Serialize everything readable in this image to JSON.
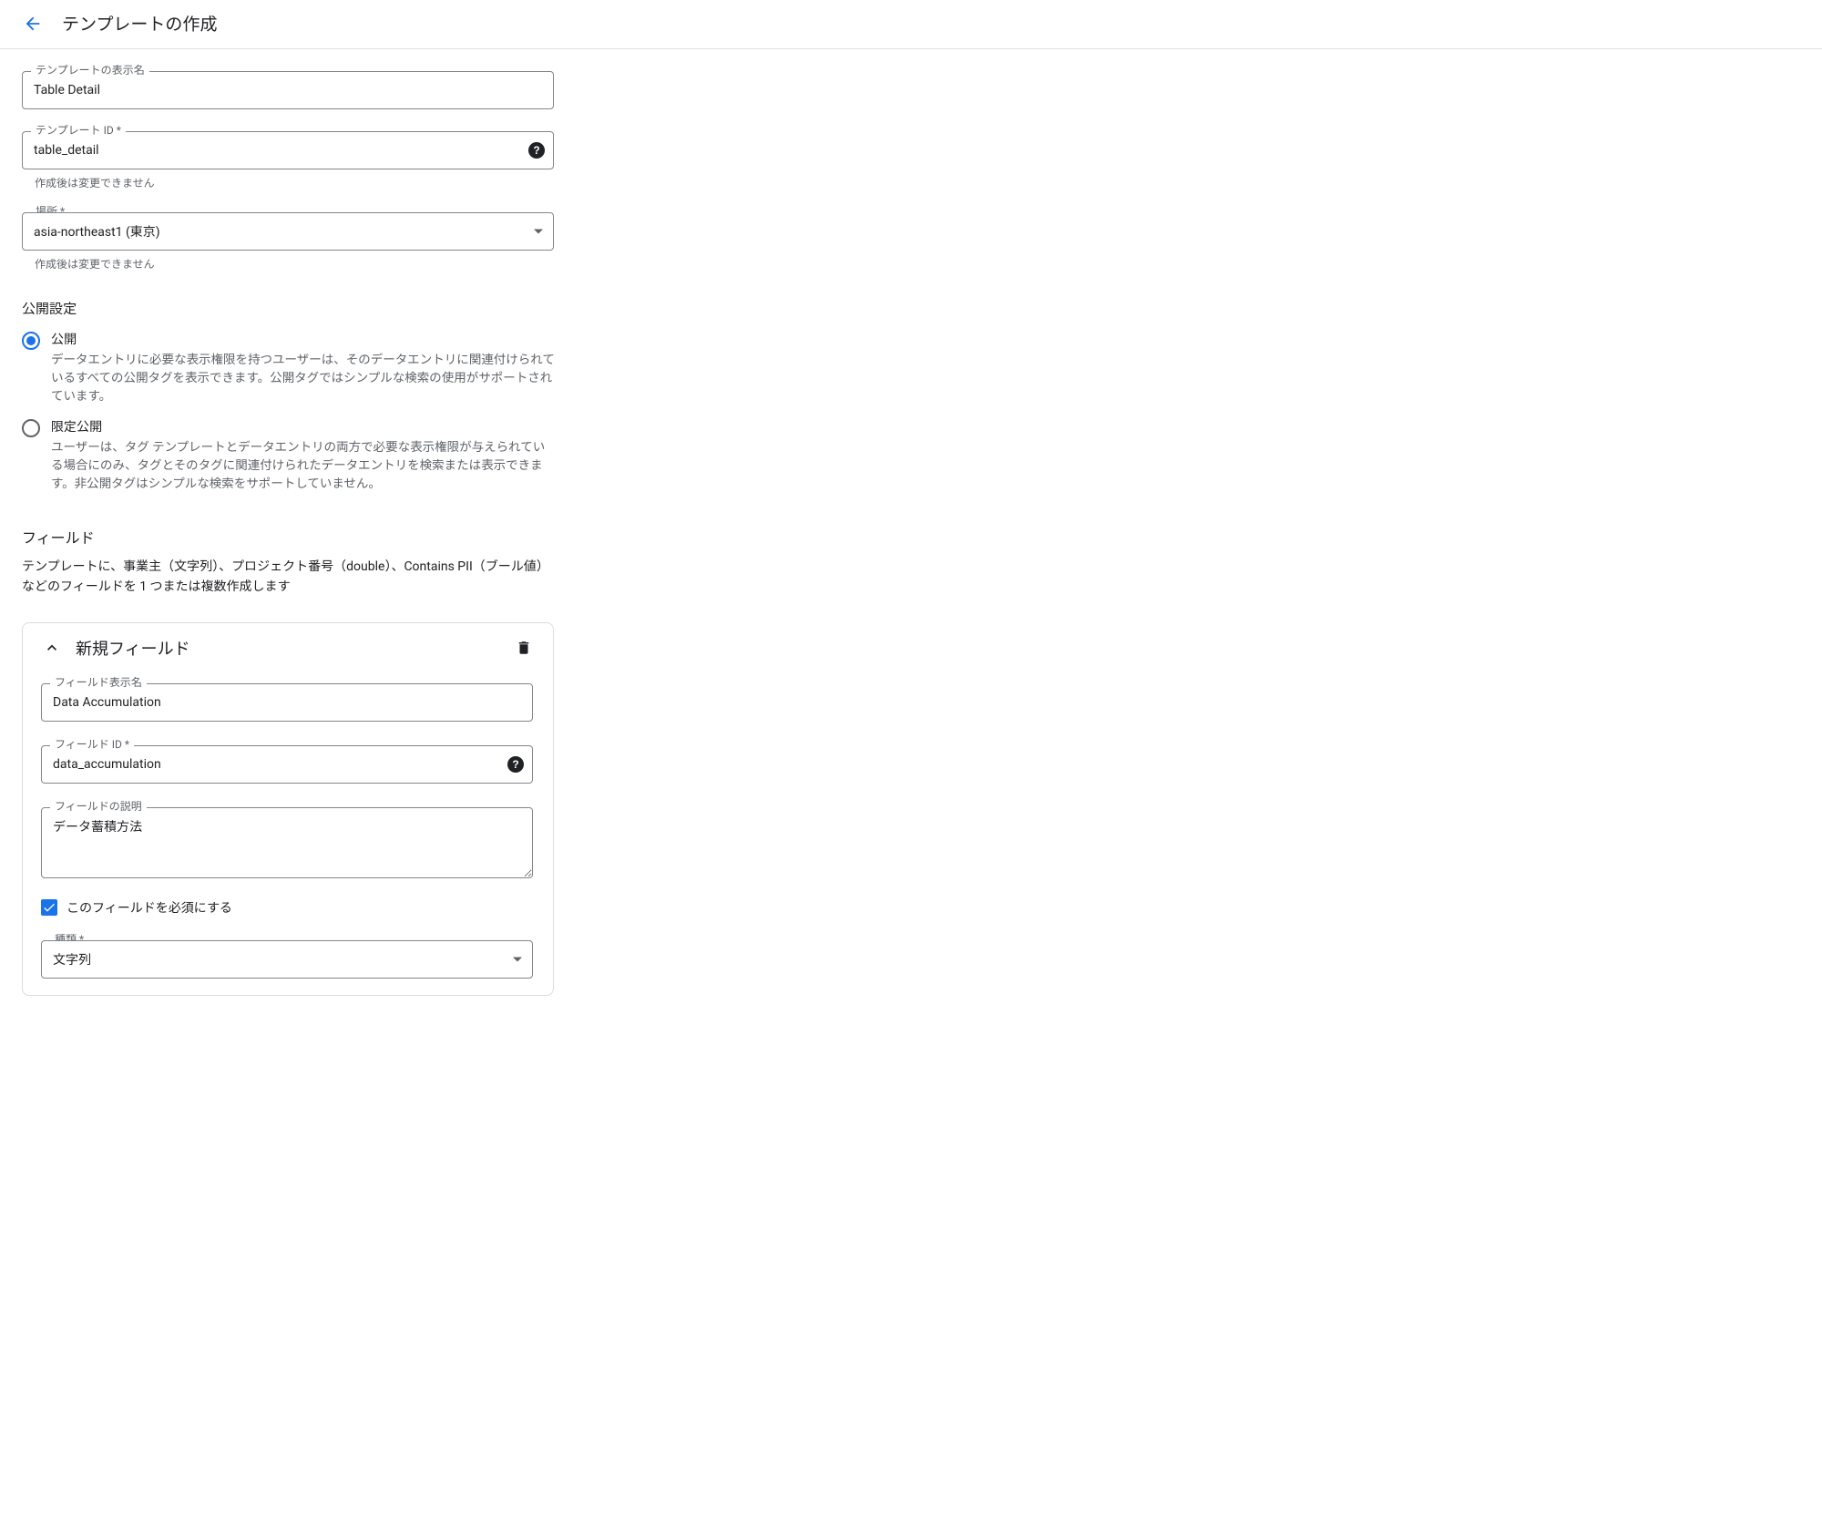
{
  "header": {
    "title": "テンプレートの作成"
  },
  "form": {
    "display_name": {
      "label": "テンプレートの表示名",
      "value": "Table Detail"
    },
    "template_id": {
      "label": "テンプレート ID *",
      "value": "table_detail",
      "hint": "作成後は変更できません"
    },
    "location": {
      "label": "場所 *",
      "value": "asia-northeast1 (東京)",
      "hint": "作成後は変更できません"
    }
  },
  "visibility": {
    "heading": "公開設定",
    "public": {
      "title": "公開",
      "desc": "データエントリに必要な表示権限を持つユーザーは、そのデータエントリに関連付けられているすべての公開タグを表示できます。公開タグではシンプルな検索の使用がサポートされています。"
    },
    "private": {
      "title": "限定公開",
      "desc": "ユーザーは、タグ テンプレートとデータエントリの両方で必要な表示権限が与えられている場合にのみ、タグとそのタグに関連付けられたデータエントリを検索または表示できます。非公開タグはシンプルな検索をサポートしていません。"
    }
  },
  "fields_section": {
    "heading": "フィールド",
    "intro": "テンプレートに、事業主（文字列）、プロジェクト番号（double）、Contains PII（ブール値）などのフィールドを 1 つまたは複数作成します"
  },
  "new_field": {
    "card_title": "新規フィールド",
    "display_name": {
      "label": "フィールド表示名",
      "value": "Data Accumulation"
    },
    "field_id": {
      "label": "フィールド ID *",
      "value": "data_accumulation"
    },
    "description": {
      "label": "フィールドの説明",
      "value": "データ蓄積方法"
    },
    "required_label": "このフィールドを必須にする",
    "type": {
      "label": "種類 *",
      "value": "文字列"
    }
  }
}
